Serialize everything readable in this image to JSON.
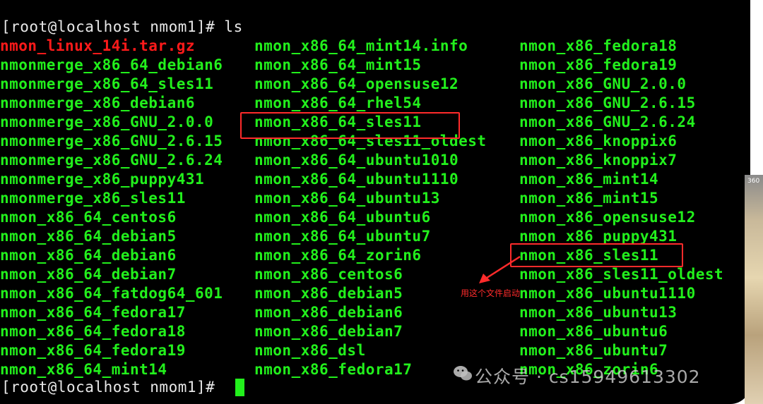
{
  "terminal": {
    "prompt_top": "[root@localhost nmom1]# ls",
    "prompt_bottom": "[root@localhost nmom1]# ",
    "col1": [
      "nmon_linux_14i.tar.gz",
      "nmonmerge_x86_64_debian6",
      "nmonmerge_x86_64_sles11",
      "nmonmerge_x86_debian6",
      "nmonmerge_x86_GNU_2.0.0",
      "nmonmerge_x86_GNU_2.6.15",
      "nmonmerge_x86_GNU_2.6.24",
      "nmonmerge_x86_puppy431",
      "nmonmerge_x86_sles11",
      "nmon_x86_64_centos6",
      "nmon_x86_64_debian5",
      "nmon_x86_64_debian6",
      "nmon_x86_64_debian7",
      "nmon_x86_64_fatdog64_601",
      "nmon_x86_64_fedora17",
      "nmon_x86_64_fedora18",
      "nmon_x86_64_fedora19",
      "nmon_x86_64_mint14"
    ],
    "col2": [
      "nmon_x86_64_mint14.info",
      "nmon_x86_64_mint15",
      "nmon_x86_64_opensuse12",
      "nmon_x86_64_rhel54",
      "nmon_x86_64_sles11",
      "nmon_x86_64_sles11_oldest",
      "nmon_x86_64_ubuntu1010",
      "nmon_x86_64_ubuntu1110",
      "nmon_x86_64_ubuntu13",
      "nmon_x86_64_ubuntu6",
      "nmon_x86_64_ubuntu7",
      "nmon_x86_64_zorin6",
      "nmon_x86_centos6",
      "nmon_x86_debian5",
      "nmon_x86_debian6",
      "nmon_x86_debian7",
      "nmon_x86_dsl",
      "nmon_x86_fedora17"
    ],
    "col3": [
      "nmon_x86_fedora18",
      "nmon_x86_fedora19",
      "nmon_x86_GNU_2.0.0",
      "nmon_x86_GNU_2.6.15",
      "nmon_x86_GNU_2.6.24",
      "nmon_x86_knoppix6",
      "nmon_x86_knoppix7",
      "nmon_x86_mint14",
      "nmon_x86_mint15",
      "nmon_x86_opensuse12",
      "nmon_x86_puppy431",
      "nmon_x86_sles11",
      "nmon_x86_sles11_oldest",
      "nmon_x86_ubuntu1110",
      "nmon_x86_ubuntu13",
      "nmon_x86_ubuntu6",
      "nmon_x86_ubuntu7",
      "nmon_x86_zorin6"
    ],
    "colors": {
      "file": "#22f01c",
      "archive": "#ff1a1a",
      "prompt": "#e8e8e8",
      "highlight": "#ff2b2b"
    }
  },
  "annotation": "用这个文件启动",
  "side_label": "360",
  "watermark": "公众号 · cs15949613302",
  "icon": "wechat-icon"
}
